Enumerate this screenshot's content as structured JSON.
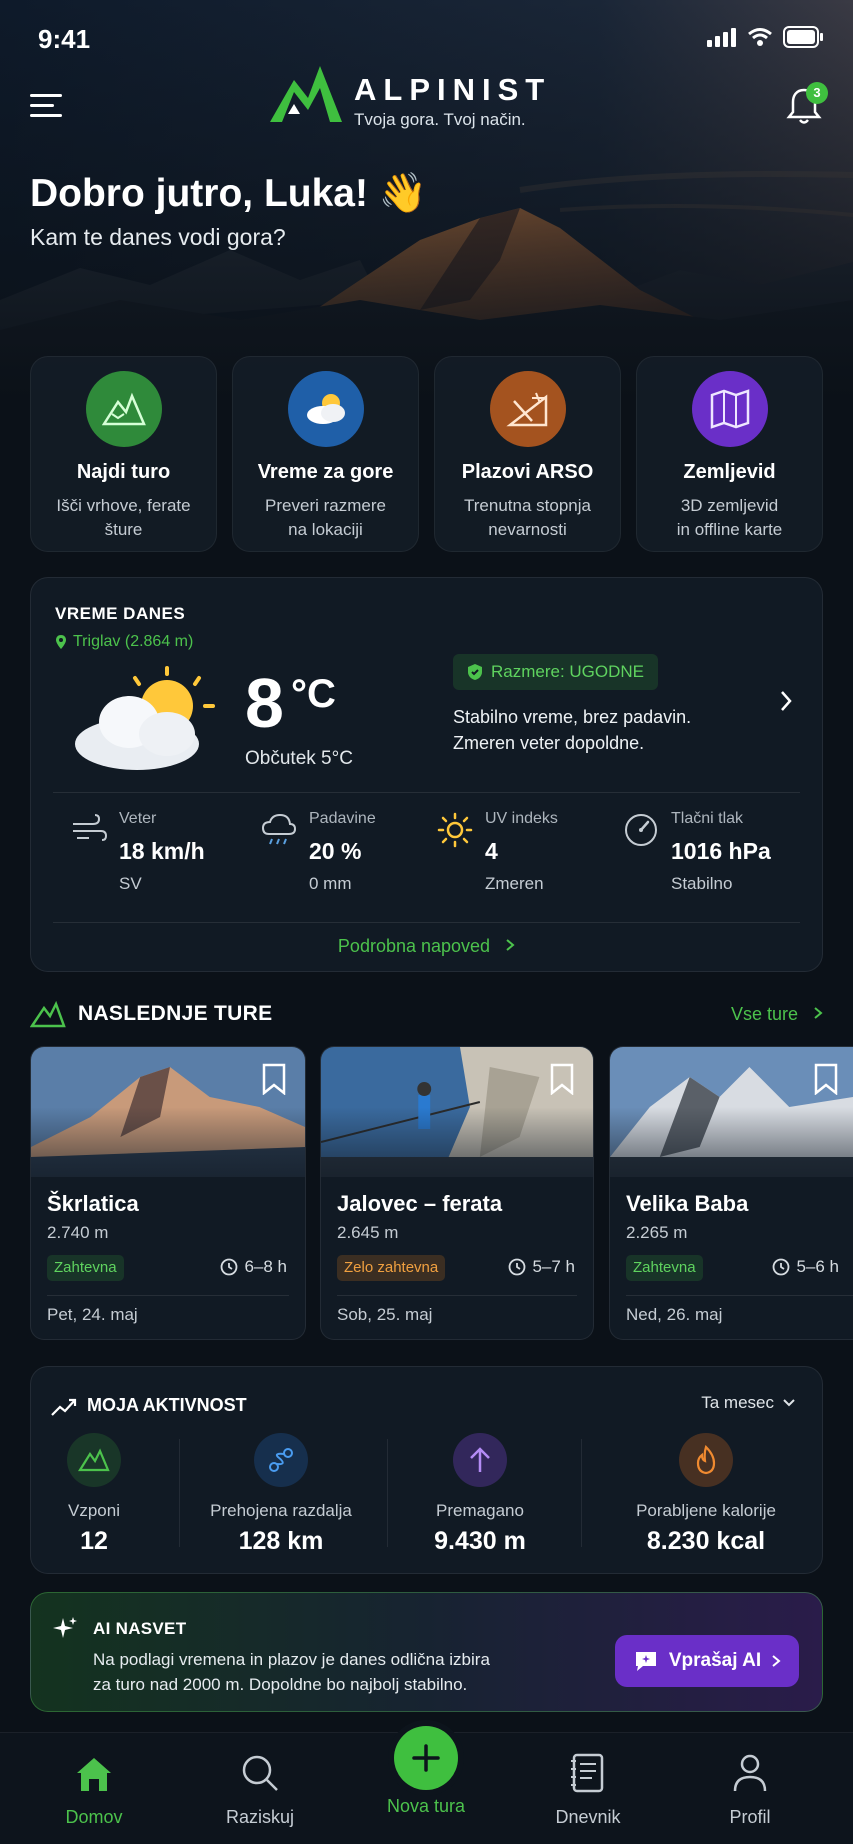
{
  "status_bar": {
    "time": "9:41"
  },
  "app": {
    "name": "ALPINIST",
    "tagline": "Tvoja gora. Tvoj način.",
    "notification_count": "3"
  },
  "greeting": {
    "title": "Dobro jutro, Luka! 👋",
    "subtitle": "Kam te danes vodi gora?"
  },
  "quick_actions": [
    {
      "title": "Najdi turo",
      "desc_line1": "Išči vrhove, ferate",
      "desc_line2": "šture",
      "icon": "mountain-icon",
      "color": "#2f8a3a"
    },
    {
      "title": "Vreme za gore",
      "desc_line1": "Preveri razmere",
      "desc_line2": "na lokaciji",
      "icon": "weather-icon",
      "color": "#1f5fa8"
    },
    {
      "title": "Plazovi ARSO",
      "desc_line1": "Trenutna stopnja",
      "desc_line2": "nevarnosti",
      "icon": "avalanche-icon",
      "color": "#a4531f"
    },
    {
      "title": "Zemljevid",
      "desc_line1": "3D zemljevid",
      "desc_line2": "in offline karte",
      "icon": "map-icon",
      "color": "#6a2fc8"
    }
  ],
  "weather": {
    "label": "VREME DANES",
    "location": "Triglav (2.864 m)",
    "temperature": "8",
    "unit": "°C",
    "feels_like": "Občutek 5°C",
    "condition_badge": "Razmere: UGODNE",
    "condition_line1": "Stabilno vreme, brez padavin.",
    "condition_line2": "Zmeren veter dopoldne.",
    "stats": [
      {
        "label": "Veter",
        "value": "18 km/h",
        "sub": "SV",
        "icon": "wind-icon"
      },
      {
        "label": "Padavine",
        "value": "20 %",
        "sub": "0 mm",
        "icon": "rain-cloud-icon"
      },
      {
        "label": "UV indeks",
        "value": "4",
        "sub": "Zmeren",
        "icon": "sun-icon"
      },
      {
        "label": "Tlačni tlak",
        "value": "1016 hPa",
        "sub": "Stabilno",
        "icon": "gauge-icon"
      }
    ],
    "forecast_link": "Podrobna napoved"
  },
  "tours_section": {
    "title": "NASLEDNJE TURE",
    "all_link": "Vse ture"
  },
  "tours": [
    {
      "name": "Škrlatica",
      "altitude": "2.740 m",
      "difficulty": "Zahtevna",
      "difficulty_color": "green",
      "duration": "6–8 h",
      "date": "Pet, 24. maj"
    },
    {
      "name": "Jalovec – ferata",
      "altitude": "2.645 m",
      "difficulty": "Zelo zahtevna",
      "difficulty_color": "orange",
      "duration": "5–7 h",
      "date": "Sob, 25. maj"
    },
    {
      "name": "Velika Baba",
      "altitude": "2.265 m",
      "difficulty": "Zahtevna",
      "difficulty_color": "green",
      "duration": "5–6 h",
      "date": "Ned, 26. maj"
    }
  ],
  "activity": {
    "title": "MOJA AKTIVNOST",
    "period": "Ta mesec",
    "stats": [
      {
        "label": "Vzponi",
        "value": "12",
        "icon": "mountain-icon"
      },
      {
        "label": "Prehojena razdalja",
        "value": "128 km",
        "icon": "route-icon"
      },
      {
        "label": "Premagano",
        "value": "9.430 m",
        "icon": "arrow-up-icon"
      },
      {
        "label": "Porabljene kalorije",
        "value": "8.230 kcal",
        "icon": "flame-icon"
      }
    ]
  },
  "ai_tip": {
    "label": "AI NASVET",
    "line1": "Na podlagi vremena in plazov je danes odlična izbira",
    "line2": "za turo nad 2000 m. Dopoldne bo najbolj stabilno.",
    "button": "Vprašaj AI"
  },
  "tabbar": {
    "home": "Domov",
    "explore": "Raziskuj",
    "new_tour": "Nova tura",
    "journal": "Dnevnik",
    "profile": "Profil"
  },
  "colors": {
    "accent": "#4cc24c",
    "background": "#0b1118",
    "card": "#111a24",
    "ai_button": "#6a2fc8"
  }
}
